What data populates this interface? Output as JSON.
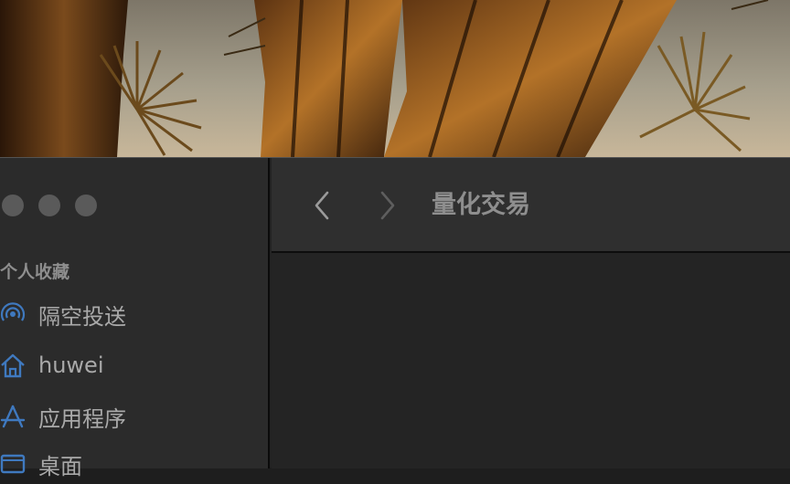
{
  "window": {
    "title": "量化交易"
  },
  "sidebar": {
    "section_heading": "个人收藏",
    "items": [
      {
        "label": "隔空投送",
        "icon": "airdrop-icon"
      },
      {
        "label": "huwei",
        "icon": "home-icon"
      },
      {
        "label": "应用程序",
        "icon": "applications-icon"
      },
      {
        "label": "桌面",
        "icon": "desktop-icon"
      }
    ]
  },
  "colors": {
    "sidebar_icon": "#3f79bf",
    "sidebar_text": "#a9a9a9",
    "heading_text": "#8e8e8e",
    "traffic_light": "#5a5a5a"
  }
}
